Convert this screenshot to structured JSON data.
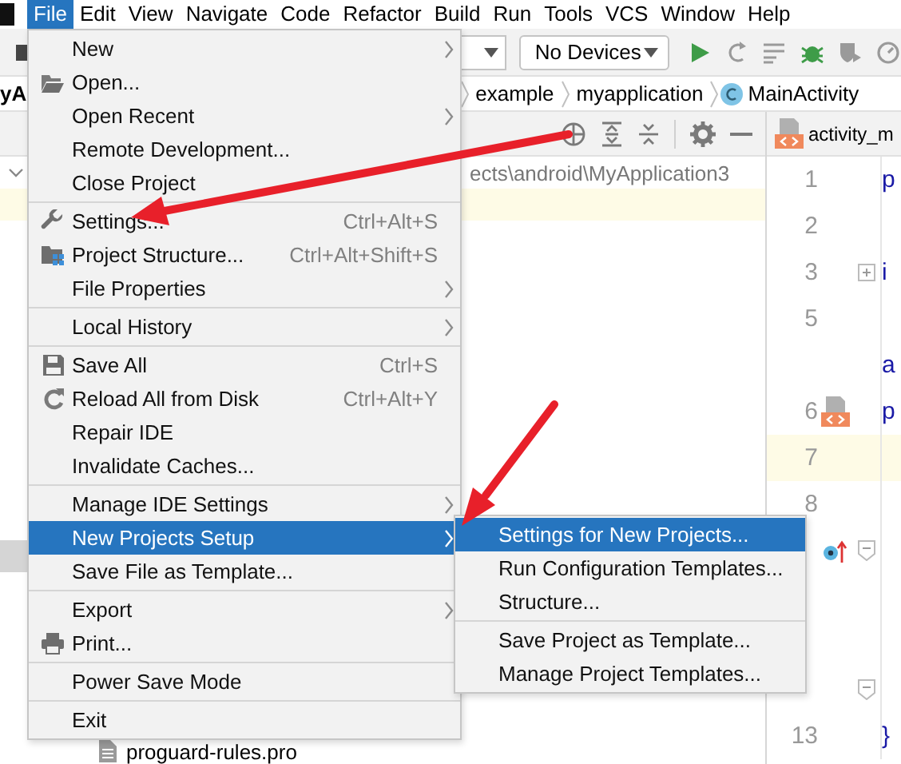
{
  "menubar": {
    "items": [
      {
        "label": "File",
        "selected": true
      },
      {
        "label": "Edit",
        "selected": false
      },
      {
        "label": "View",
        "selected": false
      },
      {
        "label": "Navigate",
        "selected": false
      },
      {
        "label": "Code",
        "selected": false
      },
      {
        "label": "Refactor",
        "selected": false
      },
      {
        "label": "Build",
        "selected": false
      },
      {
        "label": "Run",
        "selected": false
      },
      {
        "label": "Tools",
        "selected": false
      },
      {
        "label": "VCS",
        "selected": false
      },
      {
        "label": "Window",
        "selected": false
      },
      {
        "label": "Help",
        "selected": false
      }
    ]
  },
  "toolbar": {
    "device_selector": "No Devices"
  },
  "breadcrumb": {
    "lead": "yA",
    "items": [
      {
        "label": "example"
      },
      {
        "label": "myapplication"
      },
      {
        "label": "MainActivity",
        "kind": "class"
      }
    ]
  },
  "project_panel": {
    "path": "ects\\android\\MyApplication3",
    "files": [
      {
        "label": "proguard-rules.pro"
      }
    ]
  },
  "editor": {
    "tab": "activity_m",
    "lines": [
      {
        "number": "1",
        "code": "p",
        "kind": "plain",
        "current": false
      },
      {
        "number": "2",
        "kind": "plain",
        "current": false
      },
      {
        "number": "3",
        "code": "i",
        "kind": "fold-expand",
        "current": false
      },
      {
        "number": "5",
        "kind": "plain",
        "current": false
      },
      {
        "code": "a",
        "kind": "plain",
        "current": false
      },
      {
        "number": "6",
        "code": "p",
        "kind": "layout-marker",
        "current": false
      },
      {
        "number": "7",
        "kind": "plain",
        "current": true
      },
      {
        "number": "8",
        "kind": "plain",
        "current": false
      },
      {
        "kind": "override-fold",
        "current": false
      },
      {
        "kind": "plain",
        "current": false
      },
      {
        "kind": "plain",
        "current": false
      },
      {
        "kind": "fold-end",
        "current": false
      },
      {
        "number": "13",
        "code": "}",
        "kind": "plain",
        "current": false
      }
    ]
  },
  "file_menu": {
    "sections": [
      [
        {
          "label": "New",
          "submenu": true,
          "selected": false
        },
        {
          "label": "Open...",
          "kind": "folder",
          "submenu": false,
          "selected": false
        },
        {
          "label": "Open Recent",
          "submenu": true,
          "selected": false
        },
        {
          "label": "Remote Development...",
          "submenu": false,
          "selected": false
        },
        {
          "label": "Close Project",
          "submenu": false,
          "selected": false
        }
      ],
      [
        {
          "label": "Settings...",
          "kind": "wrench",
          "shortcut": "Ctrl+Alt+S",
          "submenu": false,
          "selected": false
        },
        {
          "label": "Project Structure...",
          "kind": "structure",
          "shortcut": "Ctrl+Alt+Shift+S",
          "submenu": false,
          "selected": false
        },
        {
          "label": "File Properties",
          "submenu": true,
          "selected": false
        }
      ],
      [
        {
          "label": "Local History",
          "submenu": true,
          "selected": false
        }
      ],
      [
        {
          "label": "Save All",
          "kind": "save",
          "shortcut": "Ctrl+S",
          "submenu": false,
          "selected": false
        },
        {
          "label": "Reload All from Disk",
          "kind": "reload",
          "shortcut": "Ctrl+Alt+Y",
          "submenu": false,
          "selected": false
        },
        {
          "label": "Repair IDE",
          "submenu": false,
          "selected": false
        },
        {
          "label": "Invalidate Caches...",
          "submenu": false,
          "selected": false
        }
      ],
      [
        {
          "label": "Manage IDE Settings",
          "submenu": true,
          "selected": false
        },
        {
          "label": "New Projects Setup",
          "submenu": true,
          "selected": true
        },
        {
          "label": "Save File as Template...",
          "submenu": false,
          "selected": false
        }
      ],
      [
        {
          "label": "Export",
          "submenu": true,
          "selected": false
        },
        {
          "label": "Print...",
          "kind": "print",
          "submenu": false,
          "selected": false
        }
      ],
      [
        {
          "label": "Power Save Mode",
          "submenu": false,
          "selected": false
        }
      ],
      [
        {
          "label": "Exit",
          "submenu": false,
          "selected": false
        }
      ]
    ]
  },
  "submenu": {
    "sections": [
      [
        {
          "label": "Settings for New Projects...",
          "submenu": false,
          "selected": true
        },
        {
          "label": "Run Configuration Templates...",
          "submenu": false,
          "selected": false
        },
        {
          "label": "Structure...",
          "submenu": false,
          "selected": false
        }
      ],
      [
        {
          "label": "Save Project as Template...",
          "submenu": false,
          "selected": false
        },
        {
          "label": "Manage Project Templates...",
          "submenu": false,
          "selected": false
        }
      ]
    ]
  }
}
